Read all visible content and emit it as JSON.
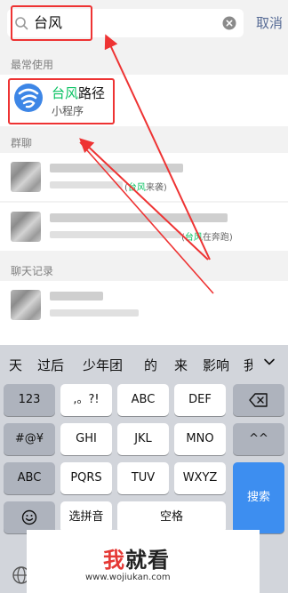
{
  "search": {
    "query": "台风",
    "cancel_label": "取消"
  },
  "sections": {
    "frequent": "最常使用",
    "groups": "群聊",
    "chat_history": "聊天记录"
  },
  "mini_program": {
    "title_hit": "台风",
    "title_rest": "路径",
    "subtitle": "小程序"
  },
  "group_results": [
    {
      "snippet_open": "(",
      "snippet_hit": "台风",
      "snippet_rest": "来袭)"
    },
    {
      "snippet_open": "(",
      "snippet_hit": "台风",
      "snippet_rest": "在奔跑)"
    }
  ],
  "keyboard": {
    "candidates": [
      "天",
      "过后",
      "少年团",
      "的",
      "来",
      "影响",
      "我"
    ],
    "row1": [
      "123",
      ",。?!",
      "ABC",
      "DEF"
    ],
    "row2": [
      "#@¥",
      "GHI",
      "JKL",
      "MNO",
      "^^"
    ],
    "row3": [
      "ABC",
      "PQRS",
      "TUV",
      "WXYZ"
    ],
    "search_key": "搜索",
    "pinyin_key": "选拼音",
    "space_key": "空格"
  },
  "watermark": {
    "brand_a": "我",
    "brand_b": "就看",
    "url": "www.wojiukan.com"
  },
  "colors": {
    "highlight_green": "#07c160",
    "annotation_red": "#e33333",
    "link_blue": "#576b95",
    "search_key_blue": "#3d8ef0"
  }
}
